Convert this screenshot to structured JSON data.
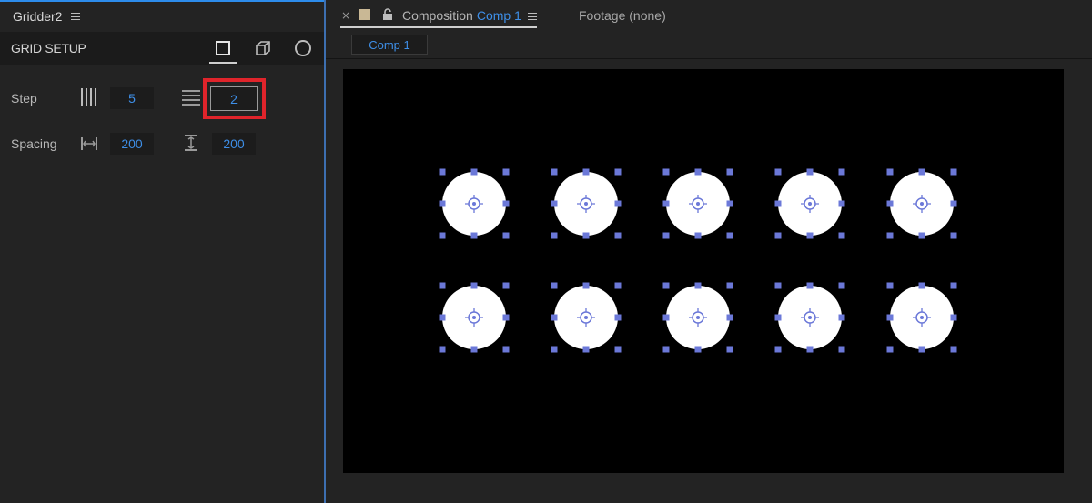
{
  "left_panel": {
    "title": "Gridder2",
    "section_title": "GRID SETUP",
    "mode_icons": [
      "square-icon",
      "cube-icon",
      "circle-icon"
    ],
    "step": {
      "label": "Step",
      "columns_value": "5",
      "rows_value": "2"
    },
    "spacing": {
      "label": "Spacing",
      "horizontal_value": "200",
      "vertical_value": "200"
    }
  },
  "composition_panel": {
    "close_icon": "×",
    "tab_prefix": "Composition",
    "tab_name": "Comp 1",
    "footage_tab": "Footage (none)",
    "breadcrumb": "Comp 1"
  },
  "canvas": {
    "columns": 5,
    "rows": 2,
    "shape": "circle",
    "fill_color": "#ffffff",
    "handle_color": "#6b78d8",
    "background": "#000000"
  },
  "colors": {
    "accent_blue": "#3e8fe8",
    "highlight_red": "#e0242b",
    "panel_bg": "#232323"
  }
}
